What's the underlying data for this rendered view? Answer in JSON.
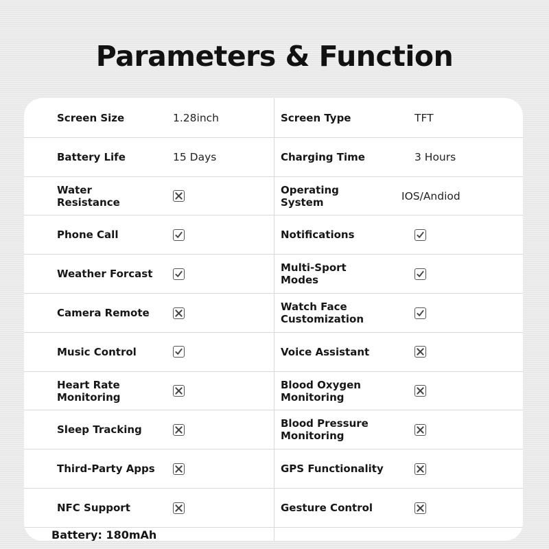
{
  "title": "Parameters & Function",
  "rows": [
    {
      "left": {
        "label": "Screen Size",
        "value": "1.28inch",
        "type": "text"
      },
      "right": {
        "label": "Screen Type",
        "value": "TFT",
        "type": "text"
      }
    },
    {
      "left": {
        "label": "Battery Life",
        "value": "15 Days",
        "type": "text"
      },
      "right": {
        "label": "Charging Time",
        "value": "3 Hours",
        "type": "text"
      }
    },
    {
      "left": {
        "label": "Water\nResistance",
        "value": "no",
        "type": "check"
      },
      "right": {
        "label": "Operating\nSystem",
        "value": "IOS/Andiod",
        "type": "text"
      }
    },
    {
      "left": {
        "label": "Phone Call",
        "value": "yes",
        "type": "check"
      },
      "right": {
        "label": "Notifications",
        "value": "yes",
        "type": "check"
      }
    },
    {
      "left": {
        "label": "Weather Forcast",
        "value": "yes",
        "type": "check"
      },
      "right": {
        "label": "Multi-Sport\nModes",
        "value": "yes",
        "type": "check"
      }
    },
    {
      "left": {
        "label": "Camera Remote",
        "value": "no",
        "type": "check"
      },
      "right": {
        "label": "Watch Face\nCustomization",
        "value": "yes",
        "type": "check"
      }
    },
    {
      "left": {
        "label": "Music Control",
        "value": "yes",
        "type": "check"
      },
      "right": {
        "label": "Voice Assistant",
        "value": "no",
        "type": "check"
      }
    },
    {
      "left": {
        "label": "Heart Rate\nMonitoring",
        "value": "no",
        "type": "check"
      },
      "right": {
        "label": "Blood Oxygen\nMonitoring",
        "value": "no",
        "type": "check"
      }
    },
    {
      "left": {
        "label": "Sleep Tracking",
        "value": "no",
        "type": "check"
      },
      "right": {
        "label": "Blood Pressure\nMonitoring",
        "value": "no",
        "type": "check"
      }
    },
    {
      "left": {
        "label": "Third-Party Apps",
        "value": "no",
        "type": "check"
      },
      "right": {
        "label": "GPS Functionality",
        "value": "no",
        "type": "check"
      }
    },
    {
      "left": {
        "label": "NFC Support",
        "value": "no",
        "type": "check"
      },
      "right": {
        "label": "Gesture Control",
        "value": "no",
        "type": "check"
      }
    }
  ],
  "footer": {
    "battery": "Battery: 180mAh"
  },
  "icons": {
    "yes": "checkbox-checked-icon",
    "no": "checkbox-crossed-icon"
  }
}
